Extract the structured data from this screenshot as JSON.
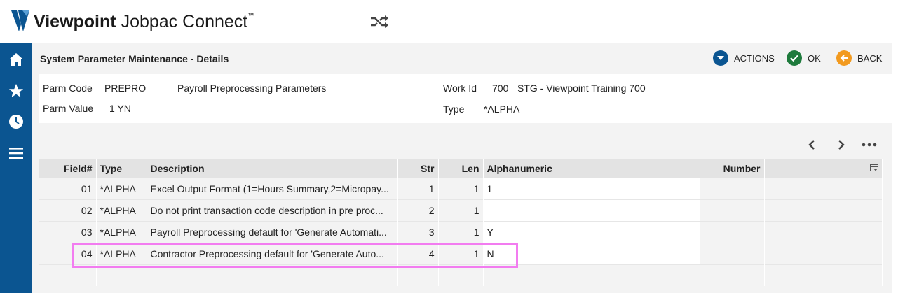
{
  "app": {
    "brand_strong": "Viewpoint",
    "brand_rest": "Jobpac Connect",
    "brand_tm": "™"
  },
  "header": {
    "title": "System Parameter Maintenance - Details",
    "actions": {
      "actions_label": "ACTIONS",
      "ok_label": "OK",
      "back_label": "BACK"
    }
  },
  "form": {
    "parm_code_label": "Parm Code",
    "parm_code_value": "PREPRO",
    "parm_code_desc": "Payroll Preprocessing Parameters",
    "parm_value_label": "Parm Value",
    "parm_value_value": "1 YN",
    "work_id_label": "Work Id",
    "work_id_value": "700",
    "work_id_desc": "STG - Viewpoint Training 700",
    "type_label": "Type",
    "type_value": "*ALPHA"
  },
  "table": {
    "headers": [
      "Field#",
      "Type",
      "Description",
      "Str",
      "Len",
      "Alphanumeric",
      "Number",
      ""
    ],
    "rows": [
      {
        "field": "01",
        "type": "*ALPHA",
        "description": "Excel Output Format (1=Hours Summary,2=Micropay...",
        "str": "1",
        "len": "1",
        "alphanumeric": "1",
        "number": ""
      },
      {
        "field": "02",
        "type": "*ALPHA",
        "description": "Do not print transaction code description in pre proc...",
        "str": "2",
        "len": "1",
        "alphanumeric": "",
        "number": ""
      },
      {
        "field": "03",
        "type": "*ALPHA",
        "description": "Payroll Preprocessing default for 'Generate Automati...",
        "str": "3",
        "len": "1",
        "alphanumeric": "Y",
        "number": ""
      },
      {
        "field": "04",
        "type": "*ALPHA",
        "description": "Contractor Preprocessing default for 'Generate Auto...",
        "str": "4",
        "len": "1",
        "alphanumeric": "N",
        "number": ""
      }
    ]
  },
  "colors": {
    "nav_bg": "#0b5591",
    "actions_blue": "#0b5591",
    "ok_green": "#1e7a3c",
    "back_orange": "#f29a1f",
    "highlight": "#f27cf0"
  },
  "icons": [
    "viewpoint-logo-icon",
    "shuffle-icon",
    "home-icon",
    "star-icon",
    "clock-icon",
    "menu-icon",
    "chevron-down-icon",
    "checkmark-icon",
    "arrow-left-icon",
    "chevron-left-icon",
    "chevron-right-icon",
    "more-icon",
    "column-settings-icon"
  ]
}
